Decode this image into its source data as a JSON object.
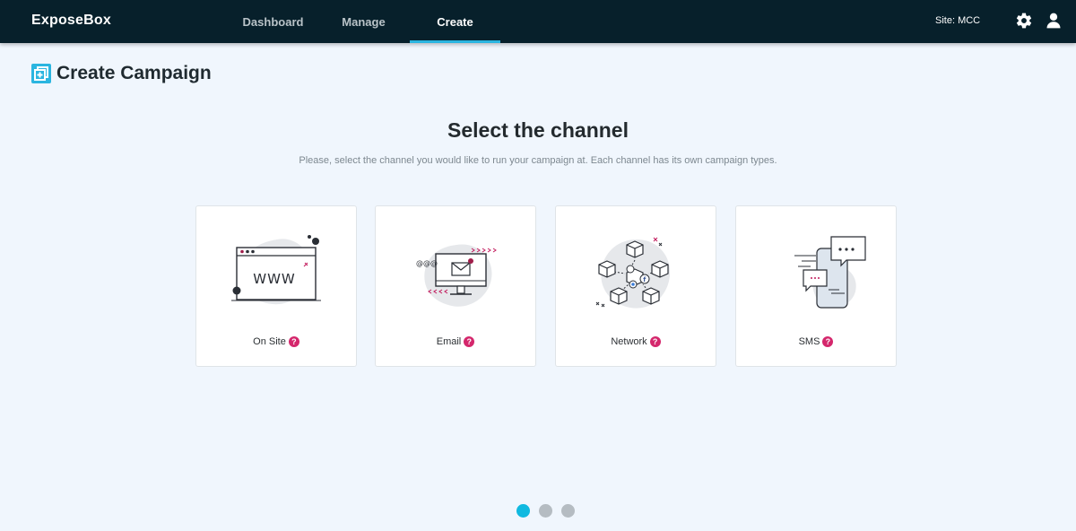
{
  "app": {
    "brand": "ExposeBox",
    "site_label": "Site:  MCC",
    "accent_color": "#2bb5e0",
    "nav_bg_color": "#07202b"
  },
  "nav": {
    "tabs": [
      {
        "label": "Dashboard",
        "active": false
      },
      {
        "label": "Manage",
        "active": false
      },
      {
        "label": "Create",
        "active": true
      }
    ],
    "icons": [
      "gear-icon",
      "user-icon"
    ]
  },
  "page": {
    "title": "Create Campaign",
    "title_icon": "create-campaign-icon"
  },
  "main": {
    "heading": "Select the channel",
    "subheading": "Please, select the channel you would like to run your campaign at. Each channel has its own campaign types."
  },
  "channels": [
    {
      "label": "On Site",
      "icon": "website-illustration-icon",
      "help": "?"
    },
    {
      "label": "Email",
      "icon": "email-illustration-icon",
      "help": "?"
    },
    {
      "label": "Network",
      "icon": "network-illustration-icon",
      "help": "?"
    },
    {
      "label": "SMS",
      "icon": "sms-illustration-icon",
      "help": "?"
    }
  ],
  "website_text": "WWW",
  "email_at_text": "@@@",
  "pagination": {
    "active_index": 0,
    "active_color": "#10b9e0",
    "inactive_color": "#b5bcc2"
  }
}
